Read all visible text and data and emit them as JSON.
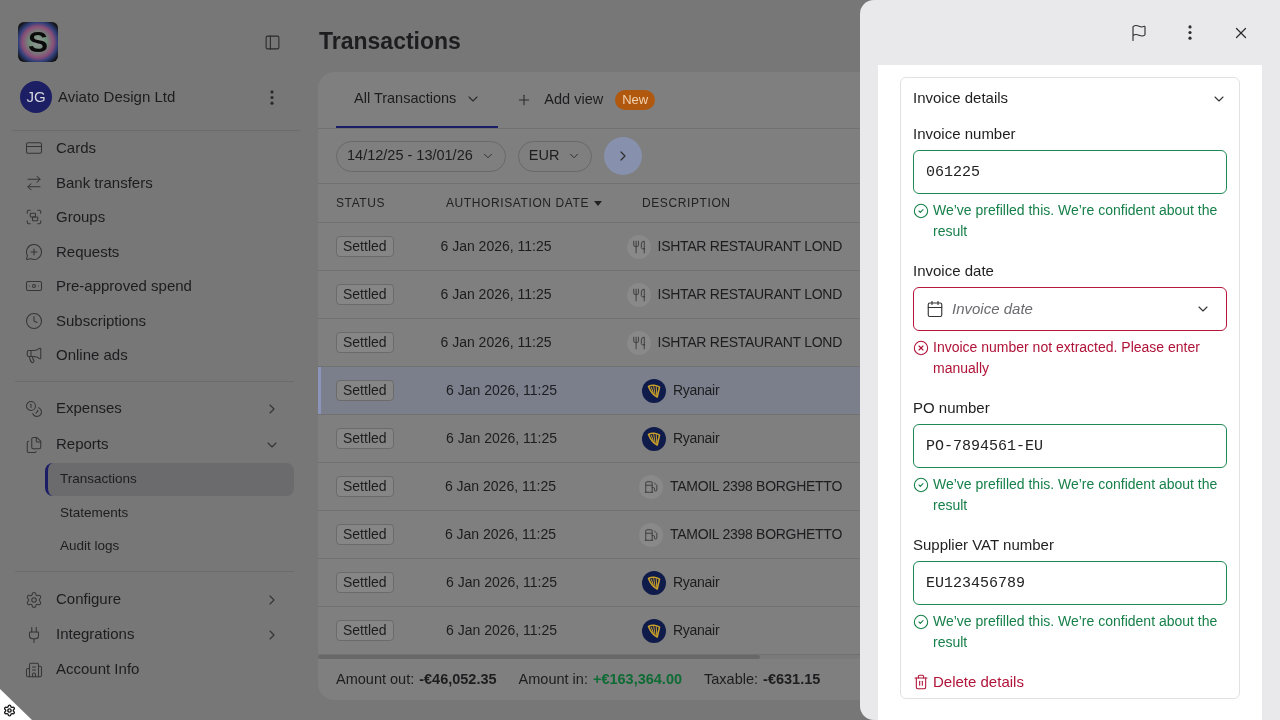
{
  "sidebar": {
    "logo": {
      "letter": "S"
    },
    "account": {
      "initials": "JG",
      "name": "Aviato Design Ltd"
    },
    "sections": [
      {
        "items": [
          {
            "kind": "link",
            "label": "Cards",
            "selected": false
          },
          {
            "kind": "link",
            "label": "Bank transfers",
            "selected": false
          },
          {
            "kind": "link",
            "label": "Groups",
            "selected": false
          },
          {
            "kind": "link",
            "label": "Requests",
            "selected": false
          },
          {
            "kind": "link",
            "label": "Pre-approved spend",
            "selected": false
          },
          {
            "kind": "link",
            "label": "Subscriptions",
            "selected": false
          },
          {
            "kind": "link",
            "label": "Online ads",
            "selected": false
          }
        ]
      },
      {
        "items": [
          {
            "kind": "group",
            "label": "Expenses",
            "expanded": false,
            "selected": false
          },
          {
            "kind": "group",
            "label": "Reports",
            "expanded": true,
            "selected": false,
            "children": [
              {
                "label": "Transactions",
                "selected": true
              },
              {
                "label": "Statements",
                "selected": false
              },
              {
                "label": "Audit logs",
                "selected": false
              }
            ]
          }
        ]
      },
      {
        "items": [
          {
            "kind": "group",
            "label": "Configure",
            "expanded": false,
            "selected": false
          },
          {
            "kind": "group",
            "label": "Integrations",
            "expanded": false,
            "selected": false
          },
          {
            "kind": "link",
            "label": "Account Info",
            "selected": false
          }
        ]
      }
    ]
  },
  "header": {
    "title": "Transactions"
  },
  "views": {
    "tabs": [
      {
        "label": "All Transactions",
        "selected": true
      }
    ],
    "add_view": {
      "label": "Add view",
      "badge": "New"
    }
  },
  "filters": [
    {
      "label": "14/12/25 - 13/01/26"
    },
    {
      "label": "EUR"
    }
  ],
  "table": {
    "columns": [
      {
        "label": "STATUS",
        "sorted": false
      },
      {
        "label": "AUTHORISATION DATE",
        "sorted": true
      },
      {
        "label": "DESCRIPTION",
        "sorted": false
      }
    ],
    "rows": [
      {
        "status": "Settled",
        "date": "6 Jan 2026, 11:25",
        "kind": "restaurant",
        "description": "ISHTAR RESTAURANT LOND",
        "selected": false
      },
      {
        "status": "Settled",
        "date": "6 Jan 2026, 11:25",
        "kind": "restaurant",
        "description": "ISHTAR RESTAURANT LOND",
        "selected": false
      },
      {
        "status": "Settled",
        "date": "6 Jan 2026, 11:25",
        "kind": "restaurant",
        "description": "ISHTAR RESTAURANT LOND",
        "selected": false
      },
      {
        "status": "Settled",
        "date": "6 Jan 2026, 11:25",
        "kind": "airline",
        "description": "Ryanair",
        "selected": true
      },
      {
        "status": "Settled",
        "date": "6 Jan 2026, 11:25",
        "kind": "airline",
        "description": "Ryanair",
        "selected": false
      },
      {
        "status": "Settled",
        "date": "6 Jan 2026, 11:25",
        "kind": "fuel",
        "description": "TAMOIL 2398 BORGHETTO",
        "selected": false
      },
      {
        "status": "Settled",
        "date": "6 Jan 2026, 11:25",
        "kind": "fuel",
        "description": "TAMOIL 2398 BORGHETTO",
        "selected": false
      },
      {
        "status": "Settled",
        "date": "6 Jan 2026, 11:25",
        "kind": "airline",
        "description": "Ryanair",
        "selected": false
      },
      {
        "status": "Settled",
        "date": "6 Jan 2026, 11:25",
        "kind": "airline",
        "description": "Ryanair",
        "selected": false
      }
    ]
  },
  "totals": [
    {
      "kind": "plain",
      "label": "Amount out:",
      "value": "-€46,052.35"
    },
    {
      "kind": "positive",
      "label": "Amount in:",
      "value": "+€163,364.00"
    },
    {
      "kind": "plain",
      "label": "Taxable:",
      "value": "-€631.15"
    }
  ],
  "details_panel": {
    "section": {
      "title": "Invoice details",
      "expanded": true,
      "fields": [
        {
          "kind": "text",
          "label": "Invoice number",
          "value": "061225",
          "error": false,
          "message": "We’ve prefilled this. We’re confident about the result"
        },
        {
          "kind": "date",
          "label": "Invoice date",
          "placeholder": "Invoice date",
          "error": true,
          "message": "Invoice number not extracted. Please enter manually"
        },
        {
          "kind": "text",
          "label": "PO number",
          "value": "PO-7894561-EU",
          "error": false,
          "message": "We’ve prefilled this. We’re confident about the result"
        },
        {
          "kind": "text",
          "label": "Supplier VAT number",
          "value": "EU123456789",
          "error": false,
          "message": "We’ve prefilled this. We’re confident about the result"
        }
      ],
      "delete_action": {
        "label": "Delete details"
      }
    }
  }
}
